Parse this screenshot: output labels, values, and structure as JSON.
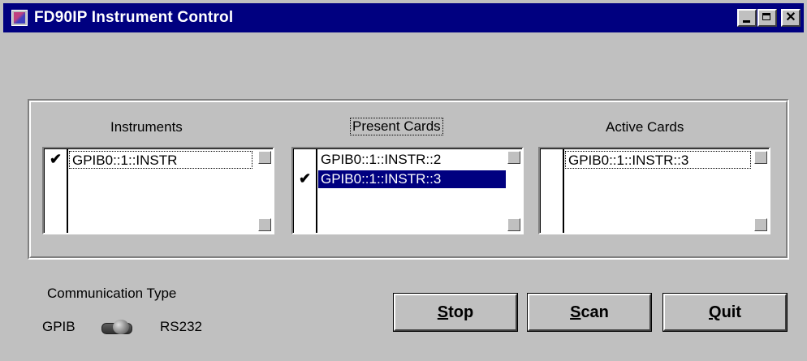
{
  "window": {
    "title": "FD90IP Instrument Control"
  },
  "columns": [
    {
      "label": "Instruments",
      "items": [
        {
          "text": "GPIB0::1::INSTR",
          "checked": true,
          "selected": false,
          "focused": true
        }
      ]
    },
    {
      "label": "Present Cards",
      "items": [
        {
          "text": "GPIB0::1::INSTR::2",
          "checked": false,
          "selected": false,
          "focused": false
        },
        {
          "text": "GPIB0::1::INSTR::3",
          "checked": true,
          "selected": true,
          "focused": false
        }
      ]
    },
    {
      "label": "Active Cards",
      "items": [
        {
          "text": "GPIB0::1::INSTR::3",
          "checked": false,
          "selected": false,
          "focused": true
        }
      ]
    }
  ],
  "communication": {
    "label": "Communication Type",
    "left_option": "GPIB",
    "right_option": "RS232",
    "selected": "RS232"
  },
  "buttons": {
    "stop": {
      "accel": "S",
      "rest": "top"
    },
    "scan": {
      "accel": "S",
      "rest": "can"
    },
    "quit": {
      "accel": "Q",
      "rest": "uit"
    }
  },
  "glyphs": {
    "check": "✔",
    "close": "✕"
  },
  "colors": {
    "titlebar": "#000080",
    "selection": "#000080",
    "face": "#c0c0c0"
  }
}
